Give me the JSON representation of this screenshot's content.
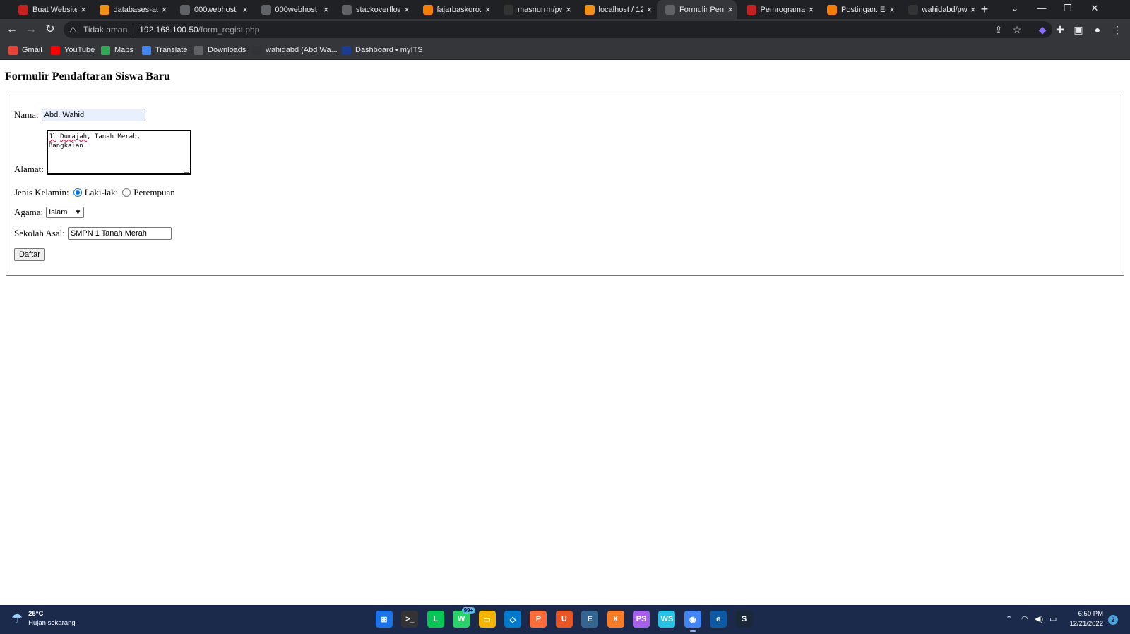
{
  "browser": {
    "tabs": [
      {
        "label": "Buat Website",
        "icon": "website-builder-icon",
        "color": "#c5221f",
        "active": false
      },
      {
        "label": "databases-au",
        "icon": "phpmyadmin-icon",
        "color": "#f29111",
        "active": false
      },
      {
        "label": "000webhost",
        "icon": "globe-icon",
        "color": "#5f6368",
        "active": false
      },
      {
        "label": "000webhost",
        "icon": "globe-icon",
        "color": "#5f6368",
        "active": false
      },
      {
        "label": "stackoverflow",
        "icon": "globe-icon",
        "color": "#5f6368",
        "active": false
      },
      {
        "label": "fajarbaskoro:",
        "icon": "blogger-icon",
        "color": "#f57d00",
        "active": false
      },
      {
        "label": "masnurrm/pw",
        "icon": "github-icon",
        "color": "#333333",
        "active": false
      },
      {
        "label": "localhost / 12",
        "icon": "phpmyadmin-icon",
        "color": "#f29111",
        "active": false
      },
      {
        "label": "Formulir Pend",
        "icon": "globe-icon",
        "color": "#5f6368",
        "active": true
      },
      {
        "label": "Pemrograman",
        "icon": "site-icon",
        "color": "#c5221f",
        "active": false
      },
      {
        "label": "Postingan: Ed",
        "icon": "blogger-icon",
        "color": "#f57d00",
        "active": false
      },
      {
        "label": "wahidabd/pw",
        "icon": "github-icon",
        "color": "#333333",
        "active": false
      }
    ],
    "tab_close_glyph": "×",
    "new_tab_glyph": "+",
    "address": {
      "security_label": "Tidak aman",
      "host": "192.168.100.50",
      "path": "/form_regist.php"
    },
    "bookmarks": [
      {
        "label": "Gmail",
        "icon": "gmail-icon",
        "color": "#ea4335"
      },
      {
        "label": "YouTube",
        "icon": "youtube-icon",
        "color": "#ff0000"
      },
      {
        "label": "Maps",
        "icon": "maps-icon",
        "color": "#34a853"
      },
      {
        "label": "Translate",
        "icon": "translate-icon",
        "color": "#4285f4"
      },
      {
        "label": "Downloads",
        "icon": "download-icon",
        "color": "#5f6368"
      },
      {
        "label": "wahidabd (Abd Wa...",
        "icon": "github-icon",
        "color": "#333333"
      },
      {
        "label": "Dashboard • myITS",
        "icon": "myits-icon",
        "color": "#1a3d8f"
      }
    ]
  },
  "form": {
    "title": "Formulir Pendaftaran Siswa Baru",
    "nama_label": "Nama:",
    "nama_value": "Abd. Wahid",
    "alamat_label": "Alamat:",
    "alamat_line1_word1": "Jl",
    "alamat_line1_word2": "Dumajah",
    "alamat_line1_rest": ", Tanah Merah,",
    "alamat_line2": "Bangkalan",
    "gender_label": "Jenis Kelamin:",
    "gender_options": [
      "Laki-laki",
      "Perempuan"
    ],
    "gender_selected": "Laki-laki",
    "agama_label": "Agama:",
    "agama_value": "Islam",
    "sekolah_label": "Sekolah Asal:",
    "sekolah_value": "SMPN 1 Tanah Merah",
    "submit_label": "Daftar"
  },
  "taskbar": {
    "weather_temp": "25°C",
    "weather_desc": "Hujan sekarang",
    "apps": [
      {
        "name": "windows-start-icon",
        "color": "#1a73e8",
        "glyph": "⊞"
      },
      {
        "name": "terminal-icon",
        "color": "#333333",
        "glyph": ">_"
      },
      {
        "name": "line-icon",
        "color": "#06c755",
        "glyph": "L"
      },
      {
        "name": "whatsapp-icon",
        "color": "#25d366",
        "glyph": "W",
        "badge": "99+"
      },
      {
        "name": "file-explorer-icon",
        "color": "#f4b400",
        "glyph": "▭"
      },
      {
        "name": "vscode-icon",
        "color": "#007acc",
        "glyph": "◇"
      },
      {
        "name": "postman-icon",
        "color": "#ff6c37",
        "glyph": "P"
      },
      {
        "name": "ubuntu-icon",
        "color": "#e95420",
        "glyph": "U"
      },
      {
        "name": "postgresql-icon",
        "color": "#336791",
        "glyph": "E"
      },
      {
        "name": "xampp-icon",
        "color": "#fb7a24",
        "glyph": "X"
      },
      {
        "name": "phpstorm-icon",
        "color": "#a85ff0",
        "glyph": "PS"
      },
      {
        "name": "webstorm-icon",
        "color": "#22c3e6",
        "glyph": "WS"
      },
      {
        "name": "chrome-icon",
        "color": "#4285f4",
        "glyph": "◉",
        "active": true
      },
      {
        "name": "edge-icon",
        "color": "#0c59a4",
        "glyph": "e"
      },
      {
        "name": "steam-icon",
        "color": "#1b2838",
        "glyph": "S"
      }
    ],
    "time": "6:50 PM",
    "date": "12/21/2022",
    "notification_count": "2"
  }
}
